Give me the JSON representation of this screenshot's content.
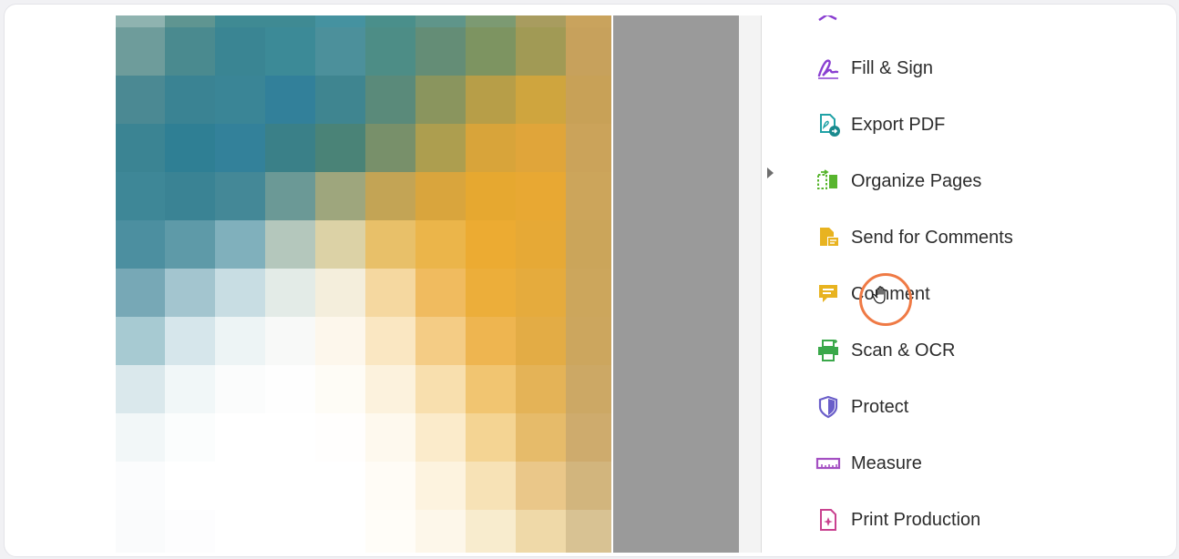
{
  "colors": {
    "fill_sign": "#8a3fd1",
    "export_pdf": "#1fa2a6",
    "organize_pages": "#58b52e",
    "send_for_comments": "#e8b320",
    "comment": "#e8b320",
    "scan_ocr": "#3aa84a",
    "protect": "#6a5ec9",
    "measure": "#a44fc2",
    "print_production": "#c9428f",
    "cursor_ring": "#ef7a45"
  },
  "tools": [
    {
      "label": "Fill & Sign",
      "icon": "fill-sign-icon"
    },
    {
      "label": "Export PDF",
      "icon": "export-pdf-icon"
    },
    {
      "label": "Organize Pages",
      "icon": "organize-pages-icon"
    },
    {
      "label": "Send for Comments",
      "icon": "send-for-comments-icon"
    },
    {
      "label": "Comment",
      "icon": "comment-icon"
    },
    {
      "label": "Scan & OCR",
      "icon": "scan-ocr-icon"
    },
    {
      "label": "Protect",
      "icon": "protect-icon"
    },
    {
      "label": "Measure",
      "icon": "measure-icon"
    },
    {
      "label": "Print Production",
      "icon": "print-production-icon"
    }
  ]
}
